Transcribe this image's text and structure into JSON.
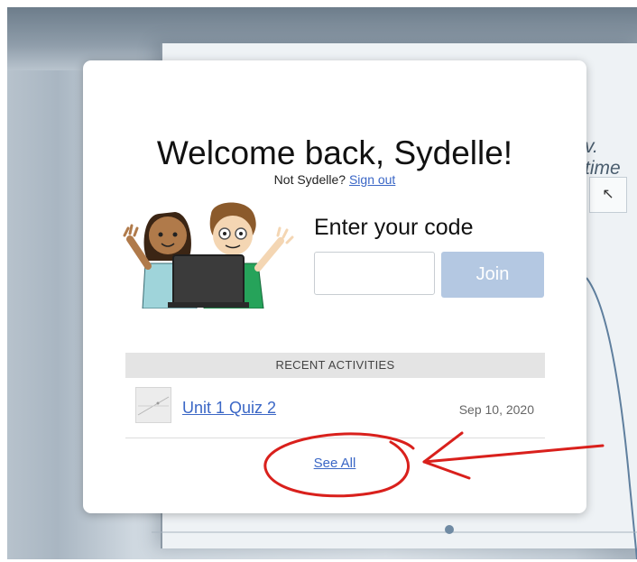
{
  "background": {
    "partial_label": "v. time"
  },
  "card": {
    "title": "Welcome back, Sydelle!",
    "not_user_text": "Not Sydelle?",
    "sign_out_label": "Sign out",
    "enter_code_label": "Enter your code",
    "code_input_value": "",
    "join_label": "Join",
    "recent_header": "RECENT ACTIVITIES",
    "activities": [
      {
        "name": "Unit 1 Quiz 2",
        "date": "Sep 10, 2020"
      }
    ],
    "see_all_label": "See All"
  },
  "colors": {
    "link": "#3b67c6",
    "join_button": "#b4c8e2",
    "annotation": "#d9201c"
  }
}
